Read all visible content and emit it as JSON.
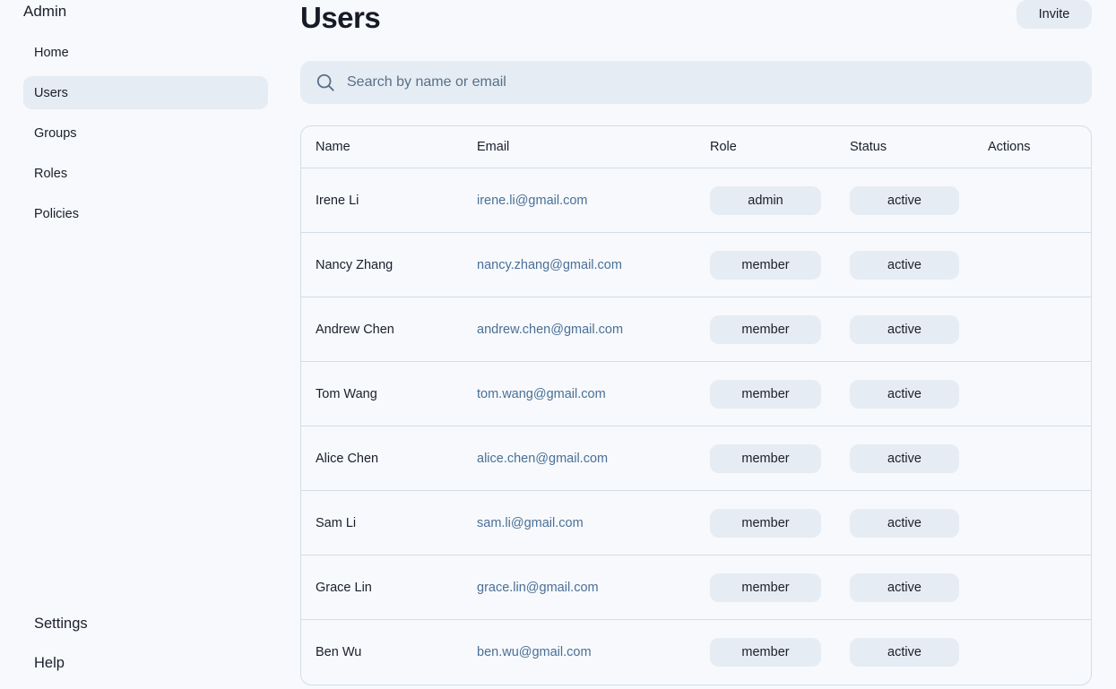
{
  "sidebar": {
    "brand": "Admin",
    "items": [
      {
        "label": "Home",
        "active": false
      },
      {
        "label": "Users",
        "active": true
      },
      {
        "label": "Groups",
        "active": false
      },
      {
        "label": "Roles",
        "active": false
      },
      {
        "label": "Policies",
        "active": false
      }
    ],
    "bottom": [
      {
        "label": "Settings"
      },
      {
        "label": "Help"
      }
    ]
  },
  "header": {
    "title": "Users",
    "invite_label": "Invite"
  },
  "search": {
    "placeholder": "Search by name or email",
    "value": "",
    "icon": "search-icon"
  },
  "table": {
    "columns": [
      "Name",
      "Email",
      "Role",
      "Status",
      "Actions"
    ],
    "rows": [
      {
        "name": "Irene Li",
        "email": "irene.li@gmail.com",
        "role": "admin",
        "status": "active"
      },
      {
        "name": "Nancy Zhang",
        "email": "nancy.zhang@gmail.com",
        "role": "member",
        "status": "active"
      },
      {
        "name": "Andrew Chen",
        "email": "andrew.chen@gmail.com",
        "role": "member",
        "status": "active"
      },
      {
        "name": "Tom Wang",
        "email": "tom.wang@gmail.com",
        "role": "member",
        "status": "active"
      },
      {
        "name": "Alice Chen",
        "email": "alice.chen@gmail.com",
        "role": "member",
        "status": "active"
      },
      {
        "name": "Sam Li",
        "email": "sam.li@gmail.com",
        "role": "member",
        "status": "active"
      },
      {
        "name": "Grace Lin",
        "email": "grace.lin@gmail.com",
        "role": "member",
        "status": "active"
      },
      {
        "name": "Ben Wu",
        "email": "ben.wu@gmail.com",
        "role": "member",
        "status": "active"
      }
    ]
  },
  "colors": {
    "background": "#f7f9fc",
    "surface": "#e6ecf3",
    "border": "#d3dde7",
    "link": "#4a7097",
    "text": "#1a1f2b"
  }
}
